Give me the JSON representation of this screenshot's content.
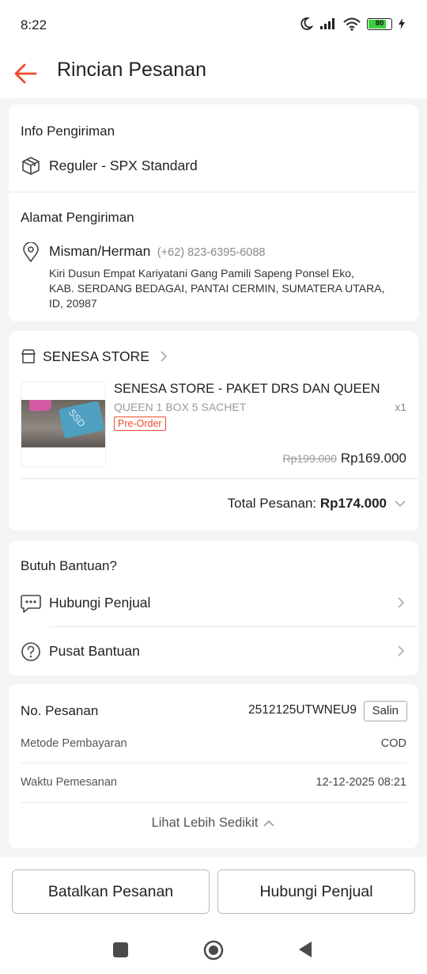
{
  "status": {
    "time": "8:22",
    "battery": "80"
  },
  "header": {
    "title": "Rincian Pesanan"
  },
  "shipping": {
    "title": "Info Pengiriman",
    "method": "Reguler - SPX Standard",
    "address_title": "Alamat Pengiriman",
    "name": "Misman/Herman",
    "phone": "(+62) 823-6395-6088",
    "address_line1": "Kiri Dusun Empat Kariyatani Gang Pamili Sapeng Ponsel Eko,",
    "address_line2": "KAB. SERDANG BEDAGAI, PANTAI CERMIN, SUMATERA UTARA,",
    "address_line3": "ID, 20987"
  },
  "store": {
    "name": "SENESA STORE",
    "product_name": "SENESA STORE - PAKET DRS DAN QUEEN",
    "variant": "QUEEN 1 BOX 5 SACHET",
    "qty": "x1",
    "badge": "Pre-Order",
    "price_old": "Rp199.000",
    "price_new": "Rp169.000",
    "total_label": "Total Pesanan:",
    "total_value": "Rp174.000",
    "thumb_text": "SSD"
  },
  "help": {
    "title": "Butuh Bantuan?",
    "contact_seller": "Hubungi Penjual",
    "help_center": "Pusat Bantuan"
  },
  "order": {
    "no_label": "No. Pesanan",
    "no_value": "2512125UTWNEU9",
    "copy_label": "Salin",
    "payment_label": "Metode Pembayaran",
    "payment_value": "COD",
    "time_label": "Waktu Pemesanan",
    "time_value": "12-12-2025 08:21",
    "see_less": "Lihat Lebih Sedikit"
  },
  "actions": {
    "cancel": "Batalkan Pesanan",
    "contact": "Hubungi Penjual"
  },
  "colors": {
    "accent": "#ee4d2d",
    "background": "#f4f4f4",
    "battery": "#3ccf3c"
  }
}
